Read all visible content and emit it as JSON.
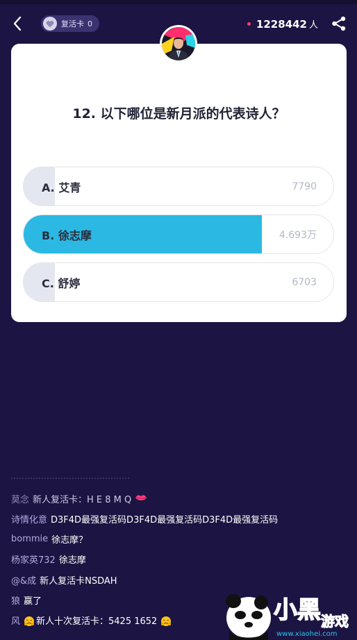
{
  "topbar": {
    "revive_card_label": "复活卡",
    "revive_card_count": "0",
    "viewer_count": "1228442",
    "viewer_unit": "人"
  },
  "question": {
    "text": "12. 以下哪位是新月派的代表诗人？",
    "options": [
      {
        "label": "A. 艾青",
        "count": "7790",
        "share": 0.1,
        "correct": false
      },
      {
        "label": "B. 徐志摩",
        "count": "4.693万",
        "share": 0.77,
        "correct": true
      },
      {
        "label": "C. 舒婷",
        "count": "6703",
        "share": 0.1,
        "correct": false
      }
    ]
  },
  "chat": [
    {
      "user": "莫念",
      "msg": "新人复活卡：H E 8 M Q",
      "emoji": "lips"
    },
    {
      "user": "诗情化意",
      "msg": "D3F4D最强复活码D3F4D最强复活码D3F4D最强复活码"
    },
    {
      "user": "bommie",
      "msg": "徐志摩？"
    },
    {
      "user": "杨家英732",
      "msg": "徐志摩"
    },
    {
      "user": "@&成",
      "msg": "新人复活卡NSDAH"
    },
    {
      "user": "狼",
      "msg": "赢了"
    },
    {
      "user": "风",
      "msg": "新人十次复活卡：5425 1652",
      "emoji": "cry"
    }
  ],
  "colors": {
    "background": "#1c1442",
    "correct": "#2bb9e3",
    "option_fill": "#e4e7ef",
    "viewer_dot": "#ff3b6b"
  },
  "icons": [
    "back-arrow-icon",
    "heart-icon",
    "share-icon",
    "host-avatar",
    "xiaohei-logo"
  ]
}
